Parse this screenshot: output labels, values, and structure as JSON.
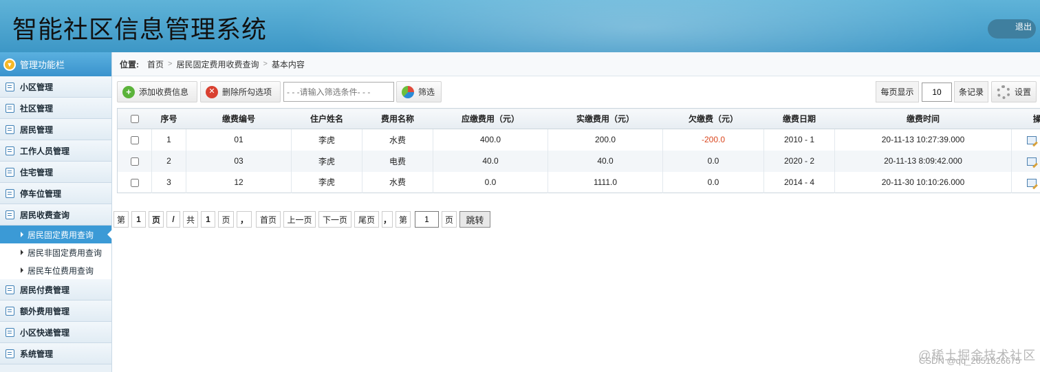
{
  "app": {
    "title": "智能社区信息管理系统",
    "logout_label": "退出"
  },
  "sidebar": {
    "header": "管理功能栏",
    "items_top": [
      {
        "label": "小区管理"
      },
      {
        "label": "社区管理"
      },
      {
        "label": "居民管理"
      },
      {
        "label": "工作人员管理"
      },
      {
        "label": "住宅管理"
      },
      {
        "label": "停车位管理"
      },
      {
        "label": "居民收费查询"
      }
    ],
    "subitems": [
      {
        "label": "居民固定费用查询",
        "active": true
      },
      {
        "label": "居民非固定费用查询"
      },
      {
        "label": "居民车位费用查询"
      }
    ],
    "items_bottom": [
      {
        "label": "居民付费管理"
      },
      {
        "label": "额外费用管理"
      },
      {
        "label": "小区快递管理"
      },
      {
        "label": "系统管理"
      }
    ]
  },
  "breadcrumb": {
    "label": "位置:",
    "items": [
      "首页",
      "居民固定费用收费查询",
      "基本内容"
    ]
  },
  "toolbar": {
    "add_label": "添加收费信息",
    "delete_label": "删除所勾选项",
    "filter_placeholder": "- - -请输入筛选条件- - -",
    "filter_button": "筛选",
    "per_page_label": "每页显示",
    "per_page_value": "10",
    "records_label": "条记录",
    "settings_label": "设置"
  },
  "table": {
    "headers": [
      "序号",
      "缴费编号",
      "住户姓名",
      "费用名称",
      "应缴费用（元）",
      "实缴费用（元）",
      "欠缴费（元）",
      "缴费日期",
      "缴费时间",
      "操作"
    ],
    "rows": [
      [
        "1",
        "01",
        "李虎",
        "水费",
        "400.0",
        "200.0",
        "-200.0",
        "2010 - 1",
        "20-11-13 10:27:39.000"
      ],
      [
        "2",
        "03",
        "李虎",
        "电费",
        "40.0",
        "40.0",
        "0.0",
        "2020 - 2",
        "20-11-13 8:09:42.000"
      ],
      [
        "3",
        "12",
        "李虎",
        "水费",
        "0.0",
        "1111.0",
        "0.0",
        "2014 - 4",
        "20-11-30 10:10:26.000"
      ]
    ]
  },
  "pager": {
    "di": "第",
    "current": "1",
    "ye": "页",
    "slash": "/",
    "gong": "共",
    "total": "1",
    "ye2": "页",
    "comma": "，",
    "first": "首页",
    "prev": "上一页",
    "next": "下一页",
    "last": "尾页",
    "comma2": "，",
    "di2": "第",
    "jump_value": "1",
    "ye3": "页",
    "go": "跳转"
  },
  "watermark": {
    "line1": "@稀土掘金技术社区",
    "line2": "CSDN @qq_2651626675"
  }
}
